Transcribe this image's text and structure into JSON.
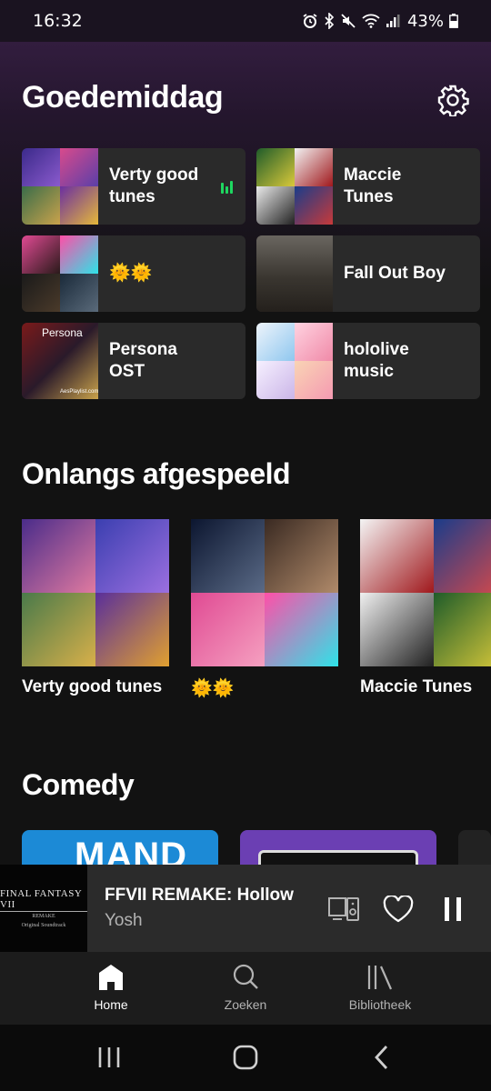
{
  "status_bar": {
    "time": "16:32",
    "battery": "43%"
  },
  "header": {
    "greeting": "Goedemiddag"
  },
  "shortcuts": [
    {
      "label": "Verty good tunes",
      "playing": true
    },
    {
      "label": "Maccie Tunes"
    },
    {
      "label": "🌞🌞"
    },
    {
      "label": "Fall Out Boy"
    },
    {
      "label": "Persona OST",
      "cover_text": "Persona",
      "cover_caption": "AesPlaylist.com"
    },
    {
      "label": "hololive music"
    }
  ],
  "recent": {
    "title": "Onlangs afgespeeld",
    "items": [
      {
        "label": "Verty good tunes"
      },
      {
        "label": "🌞🌞"
      },
      {
        "label": "Maccie Tunes"
      }
    ]
  },
  "comedy": {
    "title": "Comedy",
    "tile_text": "MAND"
  },
  "now_playing": {
    "title": "FFVII REMAKE: Hollow",
    "artist": "Yosh",
    "cover_title": "FINAL FANTASY VII",
    "cover_sub": "REMAKE",
    "cover_sub2": "Original Soundtrack"
  },
  "nav": {
    "home": "Home",
    "search": "Zoeken",
    "library": "Bibliotheek"
  },
  "colors": {
    "accent": "#1ed760",
    "background": "#121212",
    "card": "#2a2a2a"
  }
}
